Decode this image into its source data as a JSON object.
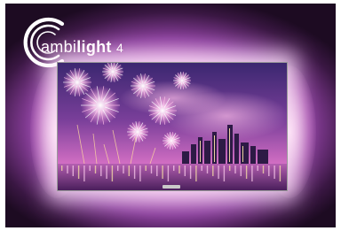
{
  "brand": {
    "logo_prefix": "ambi",
    "logo_word": "light",
    "logo_number": "4"
  },
  "colors": {
    "ambilight_glow": "#d67fd8",
    "ambilight_core": "#fff3fb",
    "sky_top": "#3b2770",
    "sky_horizon": "#d46fc4",
    "water": "#6a2f7a"
  },
  "icons": [
    "ambilight-logo-icon",
    "fireworks-image",
    "city-skyline-image"
  ]
}
